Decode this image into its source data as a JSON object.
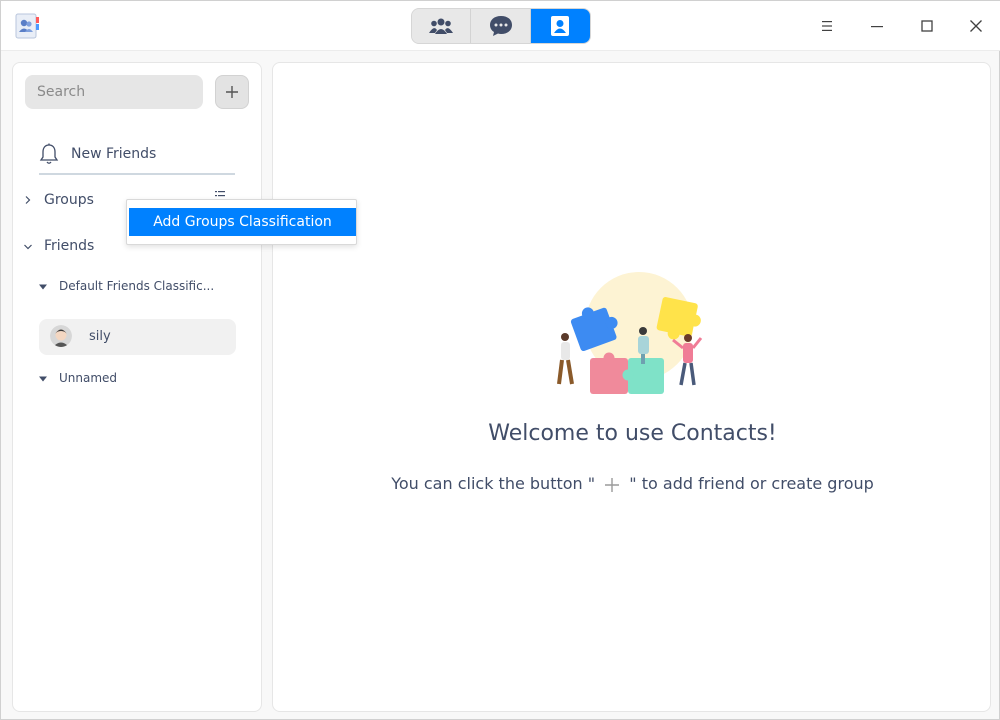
{
  "titlebar": {
    "app_icon": "contacts-app-icon",
    "view_buttons": [
      {
        "name": "groups-view",
        "icon": "people-icon",
        "active": false
      },
      {
        "name": "chat-view",
        "icon": "chat-bubble-icon",
        "active": false
      },
      {
        "name": "contacts-view",
        "icon": "contact-card-icon",
        "active": true
      }
    ],
    "window_controls": [
      "menu-icon",
      "minimize-icon",
      "maximize-icon",
      "close-icon"
    ]
  },
  "sidebar": {
    "search": {
      "placeholder": "Search",
      "value": ""
    },
    "add_button_icon": "plus-icon",
    "new_friends": {
      "label": "New Friends",
      "icon": "bell-icon"
    },
    "groups": {
      "label": "Groups",
      "expanded": false
    },
    "friends": {
      "label": "Friends",
      "expanded": true,
      "classifications": [
        {
          "label": "Default Friends Classific...",
          "contacts": [
            {
              "name": "sily"
            }
          ]
        },
        {
          "label": "Unnamed",
          "contacts": []
        }
      ]
    }
  },
  "context_menu": {
    "items": [
      {
        "label": "Add Groups Classification"
      }
    ]
  },
  "main": {
    "welcome_title": "Welcome to use Contacts!",
    "hint_before": "You can click the button \"",
    "hint_after": "\" to add friend or create group"
  },
  "colors": {
    "accent": "#0081ff",
    "text": "#414d68",
    "panel_bg": "#ffffff",
    "window_bg": "#f8f8f8"
  }
}
